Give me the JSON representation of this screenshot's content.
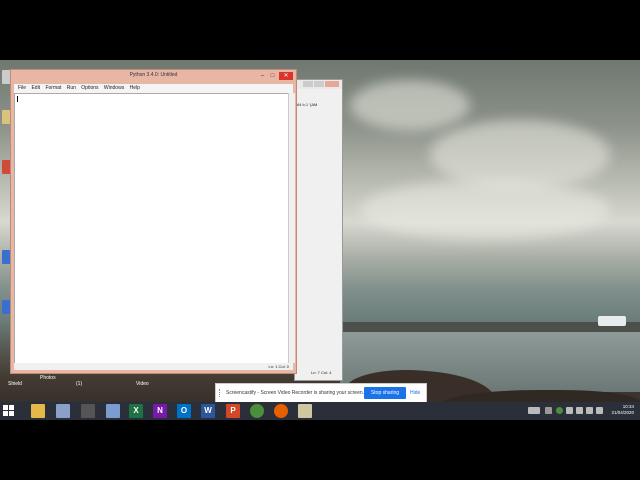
{
  "idle_window": {
    "title": "Python 3.4.0: Untitled",
    "menu": [
      "File",
      "Edit",
      "Format",
      "Run",
      "Options",
      "Windows",
      "Help"
    ],
    "status": "Ln: 1 Col: 0"
  },
  "shell_window": {
    "menu_fragment": "64  b.1 '(AM",
    "status": "Ln: 7 Col: 4"
  },
  "desktop_labels": [
    "Shield",
    "Photos",
    "(1)",
    "Video"
  ],
  "share_bar": {
    "message": "Screencastify - Screen Video Recorder is sharing your screen.",
    "stop_label": "Stop sharing",
    "hide_label": "Hide"
  },
  "taskbar": {
    "apps": [
      "file-explorer",
      "file",
      "settings",
      "notepad",
      "excel",
      "onenote",
      "outlook",
      "word",
      "powerpoint",
      "chrome",
      "firefox",
      "python-idle"
    ],
    "time": "10:34",
    "date": "21/04/2020"
  },
  "colors": {
    "idle_frame": "#e8b6a4",
    "close": "#d9352b",
    "accent": "#1a73e8",
    "taskbar": "#2b2f3a"
  }
}
